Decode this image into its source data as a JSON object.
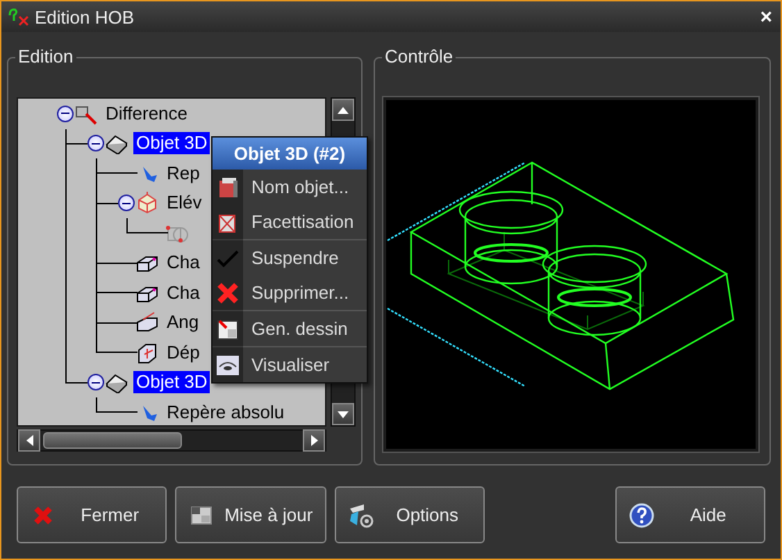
{
  "window": {
    "title": "Edition HOB",
    "close_label": "×"
  },
  "edition": {
    "title": "Edition",
    "tree": [
      {
        "label": "Difference",
        "kind": "difference",
        "expanded": true,
        "selected": false,
        "children": [
          {
            "label": "Objet 3D",
            "kind": "solid",
            "expanded": true,
            "selected": true,
            "children": [
              {
                "label": "Rep",
                "kind": "frame",
                "selected": false
              },
              {
                "label": "Elév",
                "kind": "extrude",
                "expanded": true,
                "selected": false,
                "children": [
                  {
                    "kind": "sketch",
                    "selected": false
                  }
                ]
              },
              {
                "label": "Cha",
                "kind": "chamfer",
                "selected": false
              },
              {
                "label": "Cha",
                "kind": "chamfer",
                "selected": false
              },
              {
                "label": "Ang",
                "kind": "angle",
                "selected": false
              },
              {
                "label": "Dép",
                "kind": "move",
                "selected": false
              }
            ]
          },
          {
            "label": "Objet 3D",
            "kind": "solid",
            "expanded": true,
            "selected": true,
            "children": [
              {
                "label": "Repère absolu",
                "kind": "frame",
                "selected": false
              }
            ]
          }
        ]
      }
    ]
  },
  "context_menu": {
    "title": "Objet 3D (#2)",
    "groups": [
      [
        {
          "label": "Nom objet...",
          "kind": "name"
        },
        {
          "label": "Facettisation",
          "kind": "facet"
        }
      ],
      [
        {
          "label": "Suspendre",
          "kind": "check"
        },
        {
          "label": "Supprimer...",
          "kind": "delete"
        }
      ],
      [
        {
          "label": "Gen. dessin",
          "kind": "drawing"
        }
      ],
      [
        {
          "label": "Visualiser",
          "kind": "view"
        }
      ]
    ]
  },
  "control": {
    "title": "Contrôle"
  },
  "buttons": [
    {
      "label": "Fermer",
      "kind": "close"
    },
    {
      "label": "Mise à jour",
      "kind": "update"
    },
    {
      "label": "Options",
      "kind": "options"
    },
    {
      "label": "Aide",
      "kind": "help"
    }
  ]
}
